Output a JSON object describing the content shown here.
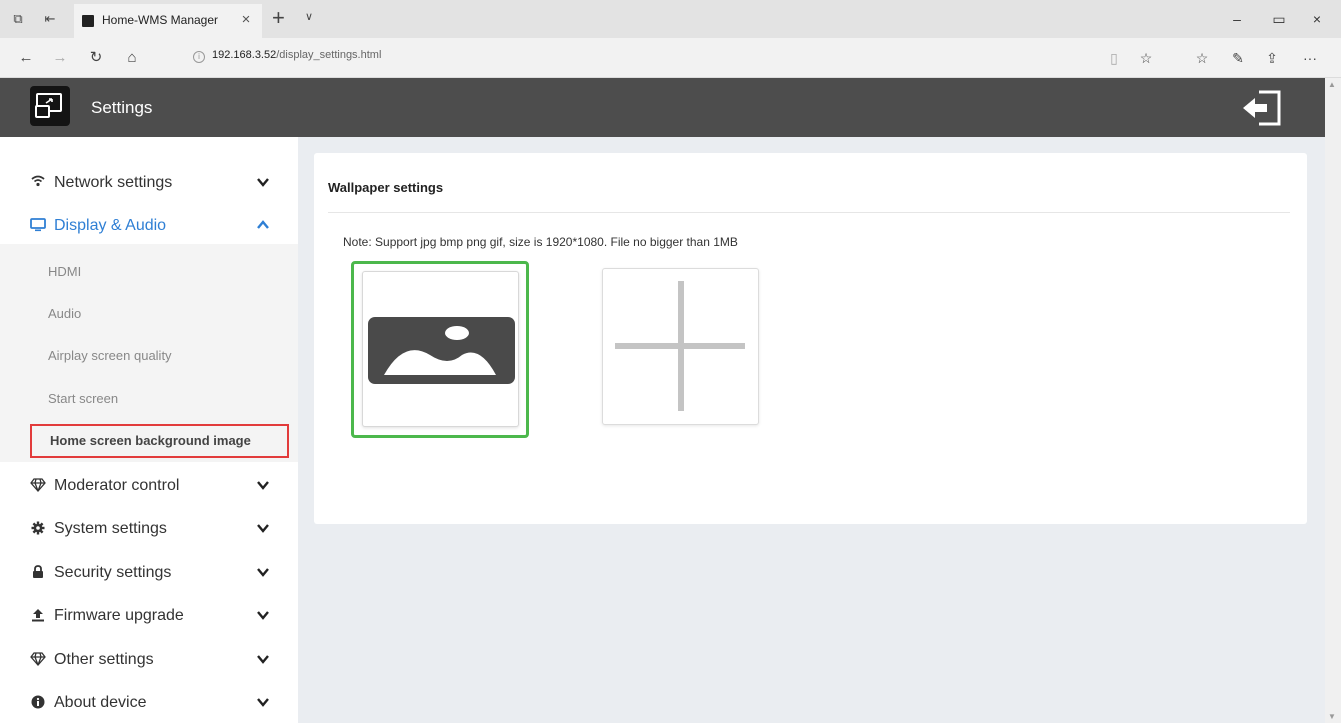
{
  "browser": {
    "tab_title": "Home-WMS Manager",
    "url_host": "192.168.3.52",
    "url_path": "/display_settings.html"
  },
  "header": {
    "title": "Settings"
  },
  "sidebar": {
    "items": [
      {
        "label": "Network settings",
        "icon": "wifi-icon"
      },
      {
        "label": "Display & Audio",
        "icon": "monitor-icon"
      },
      {
        "label": "Moderator control",
        "icon": "diamond-icon"
      },
      {
        "label": "System settings",
        "icon": "gear-icon"
      },
      {
        "label": "Security settings",
        "icon": "lock-icon"
      },
      {
        "label": "Firmware upgrade",
        "icon": "upload-icon"
      },
      {
        "label": "Other settings",
        "icon": "diamond-icon"
      },
      {
        "label": "About device",
        "icon": "info-icon"
      }
    ],
    "sub_items": [
      "HDMI",
      "Audio",
      "Airplay screen quality",
      "Start screen"
    ],
    "active_sub_item": "Home screen background image"
  },
  "content": {
    "card_title": "Wallpaper settings",
    "note": "Note: Support jpg bmp png gif, size is 1920*1080. File no bigger than 1MB"
  },
  "colors": {
    "header_bg": "#4d4d4d",
    "active_blue": "#2f7fd4",
    "selected_border": "#4cb84c",
    "highlight_red": "#e23b3b",
    "content_bg": "#eaedf1"
  }
}
